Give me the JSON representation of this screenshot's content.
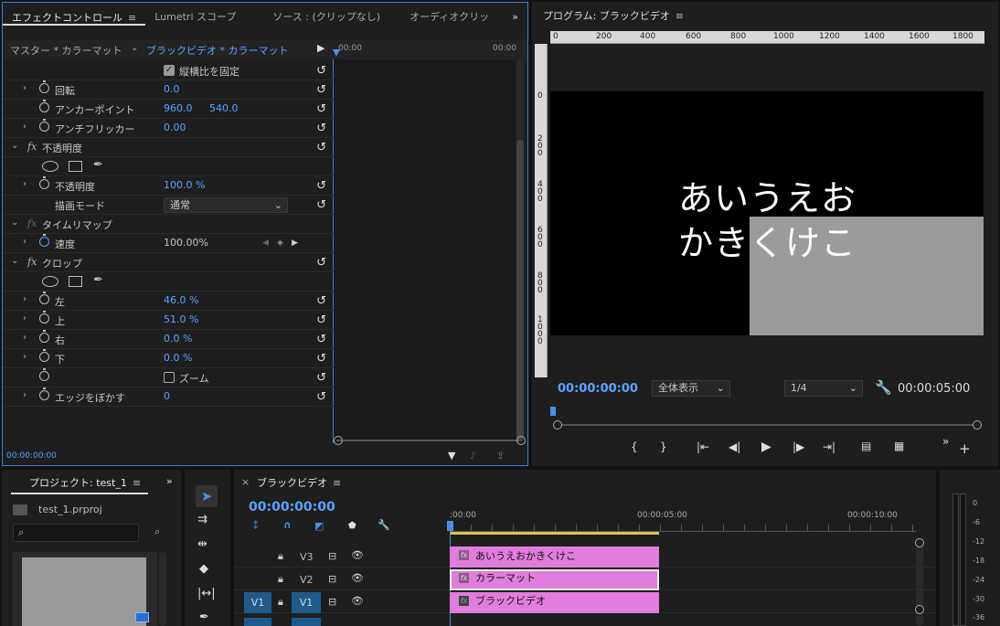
{
  "effect_controls": {
    "tabs": [
      "エフェクトコントロール",
      "Lumetri スコープ",
      "ソース : (クリップなし)",
      "オーディオクリッ"
    ],
    "source_label": "マスター * カラーマット",
    "sequence_label": "ブラックビデオ * カラーマット",
    "time_start": "00:00",
    "time_end": "00:00",
    "scale_lock_label": "縦横比を固定",
    "rotation_label": "回転",
    "rotation_value": "0.0",
    "anchor_label": "アンカーポイント",
    "anchor_x": "960.0",
    "anchor_y": "540.0",
    "antiflicker_label": "アンチフリッカー",
    "antiflicker_value": "0.00",
    "opacity_section": "不透明度",
    "opacity_label": "不透明度",
    "opacity_value": "100.0 %",
    "blend_label": "描画モード",
    "blend_value": "通常",
    "timeremap_section": "タイムリマップ",
    "speed_label": "速度",
    "speed_value": "100.00%",
    "crop_section": "クロップ",
    "crop_left_label": "左",
    "crop_left_value": "46.0 %",
    "crop_top_label": "上",
    "crop_top_value": "51.0 %",
    "crop_right_label": "右",
    "crop_right_value": "0.0 %",
    "crop_bottom_label": "下",
    "crop_bottom_value": "0.0 %",
    "zoom_label": "ズーム",
    "feather_label": "エッジをぼかす",
    "feather_value": "0",
    "timecode": "00:00:00:00"
  },
  "program": {
    "title": "プログラム: ブラックビデオ",
    "ruler_labels": [
      "0",
      "200",
      "400",
      "600",
      "800",
      "1000",
      "1200",
      "1400",
      "1600",
      "1800"
    ],
    "vruler_labels": [
      "0",
      "2 0 0",
      "4 0 0",
      "6 0 0",
      "8 0 0",
      "1 0 0 0"
    ],
    "text_line1": "あいうえお",
    "text_line2": "かきくけこ",
    "timecode": "00:00:00:00",
    "fit_value": "全体表示",
    "resolution_value": "1/4",
    "duration": "00:00:05:00"
  },
  "project": {
    "title": "プロジェクト: test_1",
    "file_name": "test_1.prproj",
    "search_placeholder": ""
  },
  "timeline": {
    "title": "ブラックビデオ",
    "timecode": "00:00:00:00",
    "ruler_labels": [
      ":00:00",
      "00:00:05:00",
      "00:00:10:00"
    ],
    "tracks": [
      "V3",
      "V2",
      "V1"
    ],
    "source_track": "V1",
    "clips": [
      "あいうえおかきくけこ",
      "カラーマット",
      "ブラックビデオ"
    ]
  },
  "meter": {
    "labels": [
      "0",
      "-6",
      "-12",
      "-18",
      "-24",
      "-30",
      "-36"
    ]
  }
}
